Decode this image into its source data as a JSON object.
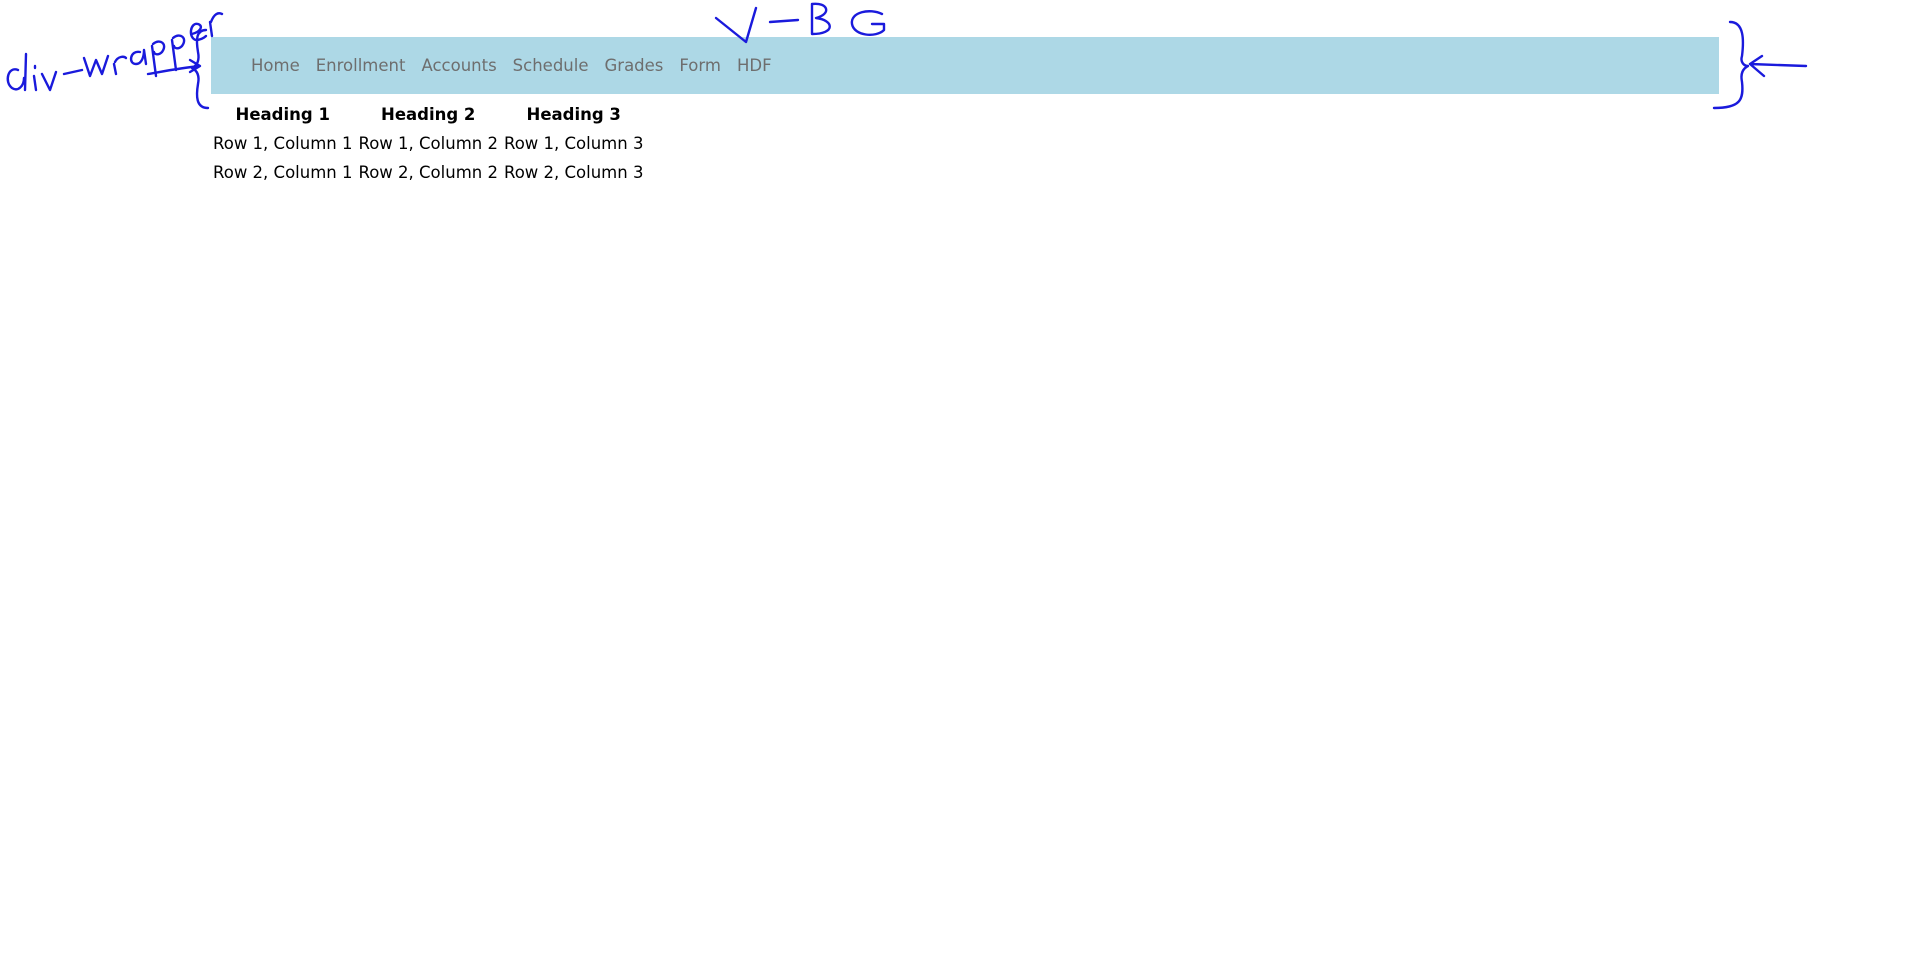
{
  "nav": {
    "items": [
      {
        "label": "Home"
      },
      {
        "label": "Enrollment"
      },
      {
        "label": "Accounts"
      },
      {
        "label": "Schedule"
      },
      {
        "label": "Grades"
      },
      {
        "label": "Form"
      },
      {
        "label": "HDF"
      }
    ],
    "background_color": "#add8e6",
    "link_color": "#6e6e6e"
  },
  "table": {
    "headers": [
      "Heading 1",
      "Heading 2",
      "Heading 3"
    ],
    "rows": [
      [
        "Row 1, Column 1",
        "Row 1, Column 2",
        "Row 1, Column 3"
      ],
      [
        "Row 2, Column 1",
        "Row 2, Column 2",
        "Row 2, Column 3"
      ]
    ]
  },
  "annotations": {
    "wrapper_label": "div-wrapper",
    "bg_label": "BG",
    "ink_color": "#1a1adc"
  }
}
